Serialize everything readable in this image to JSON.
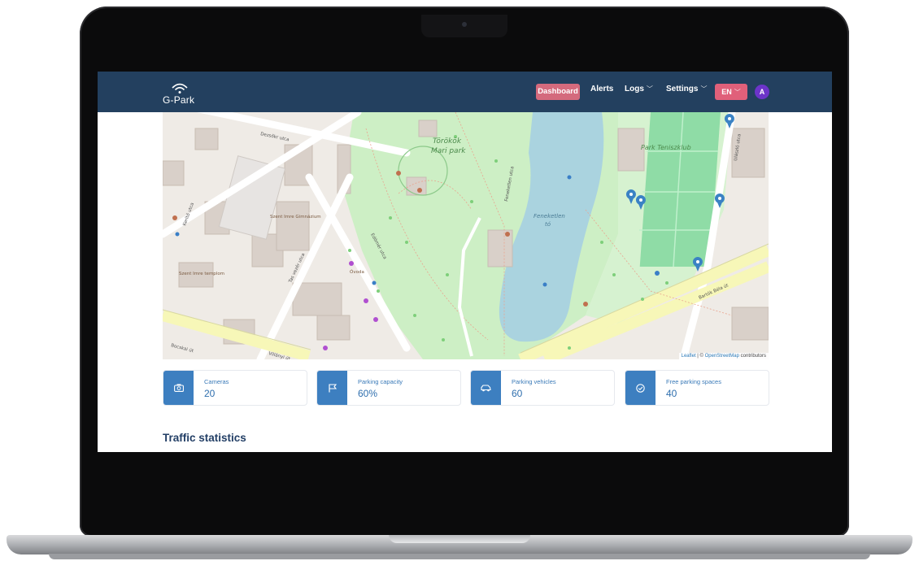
{
  "navbar": {
    "logo_text": "G-Park",
    "dashboard_label": "Dashboard",
    "alerts_label": "Alerts",
    "logs_label": "Logs",
    "settings_label": "Settings",
    "language": "EN",
    "avatar_initial": "A"
  },
  "map": {
    "labels": {
      "park_name": "Törökök",
      "park_name2": "Mari park",
      "tennis_club": "Park Teniszklub",
      "lake_name": "Feneketlen",
      "lake_suffix": "tó",
      "street_dezsoe": "Dezsőkr utca",
      "street_bocskai": "Bocskai út",
      "street_bartok": "Bartók Béla út",
      "street_villanyi": "Villányi út",
      "street_ker": "Kerítő utca",
      "street_ulo": "Ulászló utca",
      "street_karinthy": "Kelenhegyi utca",
      "street_tas": "Tas vezér utca",
      "street_feneketlen": "Feneketlen utca",
      "street_edmond": "Edömér utca",
      "poi_school": "Szent Imre Gimnázium",
      "poi_church": "Szent Imre templom",
      "poi_kindergarten": "Óvoda"
    },
    "attribution_leaflet": "Leaflet",
    "attribution_sep": " | © ",
    "attribution_osm": "OpenStreetMap",
    "attribution_suffix": " contributors"
  },
  "stats": [
    {
      "icon": "camera-icon",
      "label": "Cameras",
      "value": "20"
    },
    {
      "icon": "flag-icon",
      "label": "Parking capacity",
      "value": "60%"
    },
    {
      "icon": "car-icon",
      "label": "Parking vehicles",
      "value": "60"
    },
    {
      "icon": "check-circle-icon",
      "label": "Free parking spaces",
      "value": "40"
    }
  ],
  "section": {
    "traffic_title": "Traffic statistics"
  },
  "colors": {
    "navbar": "#23405f",
    "accent_active": "#d46a7d",
    "lang_badge": "#e0607a",
    "avatar": "#6c34c9",
    "card_icon": "#3d7fc0",
    "park_green": "#c8f0c3",
    "lake_blue": "#aad3df",
    "tennis_green": "#8ed9a4"
  }
}
